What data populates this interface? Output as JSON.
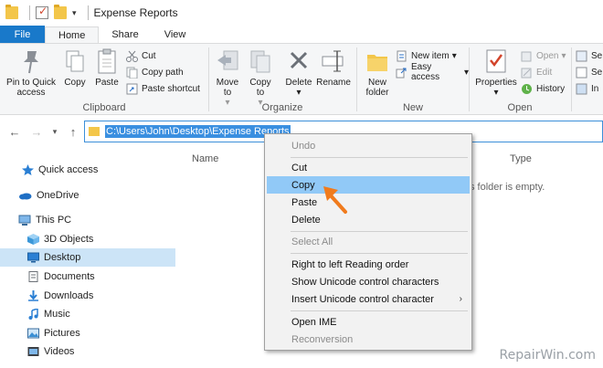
{
  "window": {
    "title": "Expense Reports"
  },
  "tabs": [
    "File",
    "Home",
    "Share",
    "View"
  ],
  "ribbon": {
    "clipboard": {
      "label": "Clipboard",
      "pin": "Pin to Quick access",
      "copy": "Copy",
      "paste": "Paste",
      "cut": "Cut",
      "copy_path": "Copy path",
      "paste_shortcut": "Paste shortcut"
    },
    "organize": {
      "label": "Organize",
      "move_to": "Move to",
      "copy_to": "Copy to",
      "delete": "Delete",
      "rename": "Rename"
    },
    "new": {
      "label": "New",
      "new_folder": "New folder",
      "new_item": "New item",
      "easy_access": "Easy access"
    },
    "open": {
      "label": "Open",
      "properties": "Properties",
      "open": "Open",
      "edit": "Edit",
      "history": "History"
    }
  },
  "address": {
    "path": "C:\\Users\\John\\Desktop\\Expense Reports"
  },
  "nav_pane": [
    {
      "label": "Quick access",
      "icon": "star-icon"
    },
    {
      "label": "OneDrive",
      "icon": "cloud-icon"
    },
    {
      "label": "This PC",
      "icon": "computer-icon"
    },
    {
      "label": "3D Objects",
      "icon": "cube-icon"
    },
    {
      "label": "Desktop",
      "icon": "desktop-icon"
    },
    {
      "label": "Documents",
      "icon": "document-icon"
    },
    {
      "label": "Downloads",
      "icon": "download-icon"
    },
    {
      "label": "Music",
      "icon": "music-icon"
    },
    {
      "label": "Pictures",
      "icon": "picture-icon"
    },
    {
      "label": "Videos",
      "icon": "video-icon"
    }
  ],
  "columns": {
    "name": "Name",
    "type": "Type"
  },
  "empty_message": "s folder is empty.",
  "context_menu": [
    {
      "label": "Undo",
      "disabled": true
    },
    {
      "label": "Cut"
    },
    {
      "label": "Copy",
      "highlighted": true
    },
    {
      "label": "Paste"
    },
    {
      "label": "Delete"
    },
    {
      "label": "Select All",
      "disabled": true
    },
    {
      "label": "Right to left Reading order"
    },
    {
      "label": "Show Unicode control characters"
    },
    {
      "label": "Insert Unicode control character",
      "submenu": true
    },
    {
      "label": "Open IME"
    },
    {
      "label": "Reconversion",
      "disabled": true
    }
  ],
  "watermark": "RepairWin.com",
  "colors": {
    "accent": "#1979ca",
    "selection": "#3a8fe0",
    "menu_highlight": "#91c9f7",
    "arrow": "#f07b1d"
  }
}
